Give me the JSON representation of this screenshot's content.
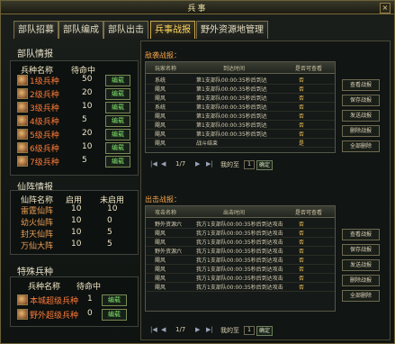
{
  "window": {
    "title": "兵事",
    "close_label": "×"
  },
  "tabs": [
    {
      "label": "部队招募"
    },
    {
      "label": "部队编成"
    },
    {
      "label": "部队出击"
    },
    {
      "label": "兵事战报"
    },
    {
      "label": "野外资源地管理"
    }
  ],
  "left": {
    "army": {
      "title": "部队情报",
      "headers": [
        "兵种名称",
        "待命中"
      ],
      "rows": [
        {
          "name": "1级兵种",
          "count": "50",
          "button": "编载"
        },
        {
          "name": "2级兵种",
          "count": "20",
          "button": "编载"
        },
        {
          "name": "3级兵种",
          "count": "10",
          "button": "编载"
        },
        {
          "name": "4级兵种",
          "count": "5",
          "button": "编载"
        },
        {
          "name": "5级兵种",
          "count": "20",
          "button": "编载"
        },
        {
          "name": "6级兵种",
          "count": "10",
          "button": "编载"
        },
        {
          "name": "7级兵种",
          "count": "5",
          "button": "编载"
        }
      ]
    },
    "fairy": {
      "title": "仙阵情报",
      "headers": [
        "仙阵名称",
        "启用",
        "未启用"
      ],
      "rows": [
        {
          "name": "雷霆仙阵",
          "on": "10",
          "off": "10"
        },
        {
          "name": "幼火仙阵",
          "on": "10",
          "off": "0"
        },
        {
          "name": "封天仙阵",
          "on": "10",
          "off": "5"
        },
        {
          "name": "万仙大阵",
          "on": "10",
          "off": "5"
        }
      ]
    },
    "special": {
      "title": "特殊兵种",
      "headers": [
        "兵种名称",
        "待命中"
      ],
      "rows": [
        {
          "name": "本城超级兵种",
          "count": "1",
          "button": "编载"
        },
        {
          "name": "野外超级兵种",
          "count": "0",
          "button": "编载"
        }
      ]
    }
  },
  "right": {
    "defense": {
      "title": "敌袭战报：",
      "headers": [
        "玩家名称",
        "到达时间",
        "是否可查看"
      ],
      "rows": [
        {
          "name": "系统",
          "time": "第1支部队00:00:35秒后到达",
          "view": "否"
        },
        {
          "name": "飓风",
          "time": "第1支部队00:00:35秒后到达",
          "view": "否"
        },
        {
          "name": "飓风",
          "time": "第1支部队00:00:35秒后到达",
          "view": "否"
        },
        {
          "name": "系统",
          "time": "第1支部队00:00:35秒后到达",
          "view": "否"
        },
        {
          "name": "飓风",
          "time": "第1支部队00:00:35秒后到达",
          "view": "否"
        },
        {
          "name": "飓风",
          "time": "第1支部队00:00:35秒后到达",
          "view": "否"
        },
        {
          "name": "飓风",
          "time": "第1支部队00:00:35秒后到达",
          "view": "否"
        },
        {
          "name": "飓风",
          "time": "战斗结束",
          "view": "是"
        }
      ],
      "buttons": [
        "查看战报",
        "保存战报",
        "发送战报",
        "删除战报",
        "全部删除"
      ],
      "pager": {
        "page": "1/7",
        "goto": "我的至",
        "go_value": "1",
        "go_btn": "确定"
      }
    },
    "attack": {
      "title": "出击战报：",
      "headers": [
        "攻击名称",
        "出击时间",
        "是否可查看"
      ],
      "rows": [
        {
          "name": "野外资源六",
          "time": "我方1支部队00:00:35秒后到达攻击",
          "view": "否"
        },
        {
          "name": "飓风",
          "time": "我方1支部队00:00:35秒后到达攻击",
          "view": "否"
        },
        {
          "name": "飓风",
          "time": "我方1支部队00:00:35秒后到达攻击",
          "view": "否"
        },
        {
          "name": "野外资源六",
          "time": "我方1支部队00:00:35秒后到达攻击",
          "view": "否"
        },
        {
          "name": "飓风",
          "time": "我方1支部队00:00:35秒后到达攻击",
          "view": "否"
        },
        {
          "name": "飓风",
          "time": "我方1支部队00:00:35秒后到达攻击",
          "view": "否"
        },
        {
          "name": "飓风",
          "time": "我方1支部队00:00:35秒后到达攻击",
          "view": "否"
        },
        {
          "name": "飓风",
          "time": "我方1支部队00:00:35秒后到达攻击",
          "view": "否"
        }
      ],
      "buttons": [
        "查看战报",
        "保存战报",
        "发送战报",
        "删除战报",
        "全部删除"
      ],
      "pager": {
        "page": "1/7",
        "goto": "我的至",
        "go_value": "1",
        "go_btn": "确定"
      }
    }
  }
}
